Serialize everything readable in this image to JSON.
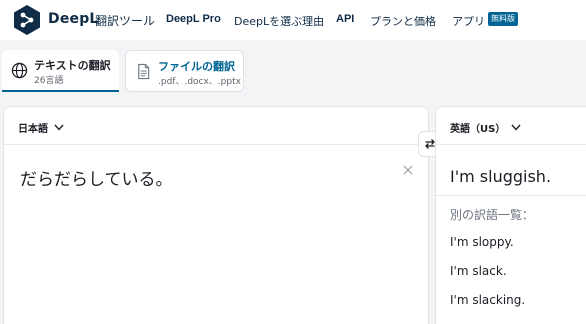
{
  "header": {
    "brand": "DeepL",
    "brand_sub": "翻訳ツール",
    "nav": {
      "pro": "DeepL Pro",
      "reason": "DeepLを選ぶ理由",
      "api": "API",
      "plans": "プランと価格",
      "apps": "アプリ",
      "apps_badge": "無料版"
    },
    "colors": {
      "brand": "#0f2b46",
      "accent": "#006494"
    }
  },
  "modes": {
    "text": {
      "title": "テキストの翻訳",
      "subtitle": "26言語",
      "icon": "globe-icon"
    },
    "document": {
      "title": "ファイルの翻訳",
      "subtitle": ".pdf、.docx、.pptx",
      "icon": "document-icon"
    }
  },
  "source": {
    "language": "日本語",
    "text": "だらだらしている。"
  },
  "target": {
    "language": "英語（US）",
    "translation": "I'm sluggish.",
    "alternatives_label": "別の訳語一覧：",
    "alternatives": [
      "I'm sloppy.",
      "I'm slack.",
      "I'm slacking."
    ]
  }
}
